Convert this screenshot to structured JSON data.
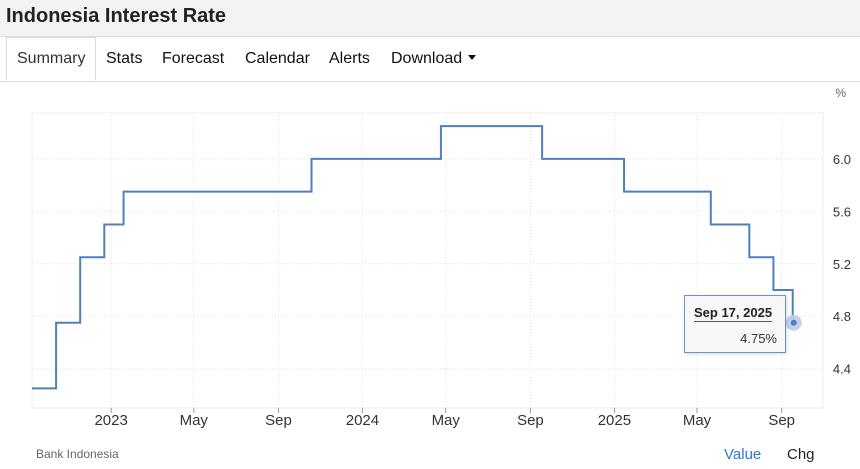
{
  "header": {
    "title": "Indonesia Interest Rate"
  },
  "tabs": [
    {
      "label": "Summary",
      "active": true
    },
    {
      "label": "Stats"
    },
    {
      "label": "Forecast"
    },
    {
      "label": "Calendar"
    },
    {
      "label": "Alerts"
    },
    {
      "label": "Download"
    }
  ],
  "footer": {
    "source": "Bank Indonesia",
    "value_label": "Value",
    "chg_label": "Chg"
  },
  "tooltip": {
    "date": "Sep 17, 2025",
    "value": "4.75%"
  },
  "colors": {
    "line": "#4f7fbf",
    "grid": "#e2e2e2",
    "accent": "#2b7bd1",
    "marker": "#b9cdea"
  },
  "chart_data": {
    "type": "line",
    "step": true,
    "unit_label": "%",
    "y_ticks": [
      4.4,
      4.8,
      5.2,
      5.6,
      6.0
    ],
    "y_tick_labels": [
      "4.4",
      "4.8",
      "5.2",
      "5.6",
      "6.0"
    ],
    "ylim": [
      4.1,
      6.35
    ],
    "xlim": [
      "2022-09-08",
      "2025-10-31"
    ],
    "x_ticks": [
      {
        "date": "2023-01-01",
        "label": "2023"
      },
      {
        "date": "2023-05-01",
        "label": "May"
      },
      {
        "date": "2023-09-01",
        "label": "Sep"
      },
      {
        "date": "2024-01-01",
        "label": "2024"
      },
      {
        "date": "2024-05-01",
        "label": "May"
      },
      {
        "date": "2024-09-01",
        "label": "Sep"
      },
      {
        "date": "2025-01-01",
        "label": "2025"
      },
      {
        "date": "2025-05-01",
        "label": "May"
      },
      {
        "date": "2025-09-01",
        "label": "Sep"
      }
    ],
    "grid": true,
    "series": [
      {
        "points": [
          {
            "x": "2022-09-08",
            "y": 4.25
          },
          {
            "x": "2022-10-13",
            "y": 4.75
          },
          {
            "x": "2022-11-17",
            "y": 5.25
          },
          {
            "x": "2022-12-22",
            "y": 5.5
          },
          {
            "x": "2023-01-19",
            "y": 5.75
          },
          {
            "x": "2023-10-19",
            "y": 6.0
          },
          {
            "x": "2024-04-24",
            "y": 6.25
          },
          {
            "x": "2024-09-18",
            "y": 6.0
          },
          {
            "x": "2025-01-15",
            "y": 5.75
          },
          {
            "x": "2025-05-21",
            "y": 5.5
          },
          {
            "x": "2025-07-16",
            "y": 5.25
          },
          {
            "x": "2025-08-20",
            "y": 5.0
          },
          {
            "x": "2025-09-17",
            "y": 4.75
          }
        ]
      }
    ]
  }
}
